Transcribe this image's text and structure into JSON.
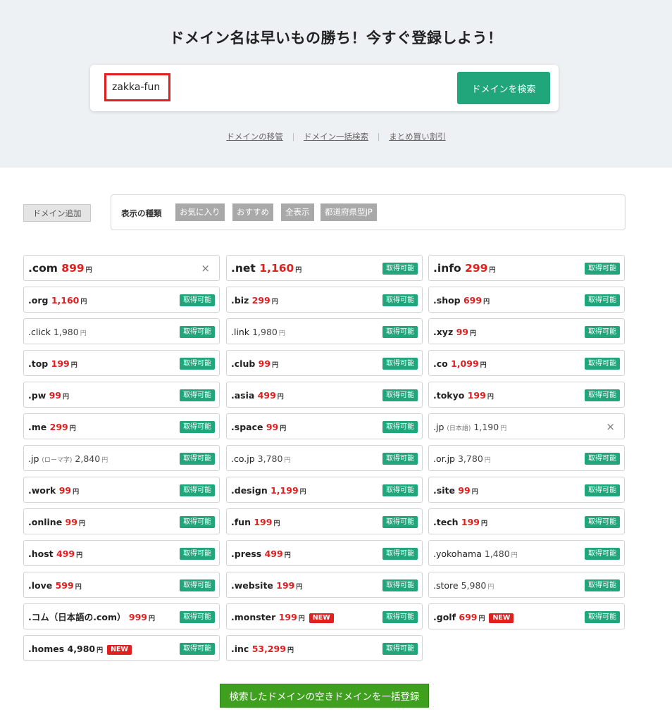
{
  "hero": {
    "title": "ドメイン名は早いもの勝ち！今すぐ登録しよう！",
    "search_value": "zakka-fun",
    "search_button": "ドメインを検索",
    "links": [
      "ドメインの移管",
      "ドメイン一括検索",
      "まとめ買い割引"
    ],
    "separator": "|"
  },
  "filters": {
    "add_button": "ドメイン追加",
    "label": "表示の種類",
    "chips": [
      "お気に入り",
      "おすすめ",
      "全表示",
      "都道府県型JP"
    ]
  },
  "yen": "円",
  "available_label": "取得可能",
  "new_label": "NEW",
  "close_symbol": "×",
  "domains": [
    {
      "tld": ".com",
      "price": "899",
      "status": "close",
      "large": true
    },
    {
      "tld": ".net",
      "price": "1,160",
      "status": "available",
      "large": true
    },
    {
      "tld": ".info",
      "price": "299",
      "status": "available",
      "large": true
    },
    {
      "tld": ".org",
      "price": "1,160",
      "status": "available"
    },
    {
      "tld": ".biz",
      "price": "299",
      "status": "available"
    },
    {
      "tld": ".shop",
      "price": "699",
      "status": "available"
    },
    {
      "tld": ".click",
      "price": "1,980",
      "status": "available",
      "plain": true
    },
    {
      "tld": ".link",
      "price": "1,980",
      "status": "available",
      "plain": true
    },
    {
      "tld": ".xyz",
      "price": "99",
      "status": "available"
    },
    {
      "tld": ".top",
      "price": "199",
      "status": "available"
    },
    {
      "tld": ".club",
      "price": "99",
      "status": "available"
    },
    {
      "tld": ".co",
      "price": "1,099",
      "status": "available"
    },
    {
      "tld": ".pw",
      "price": "99",
      "status": "available"
    },
    {
      "tld": ".asia",
      "price": "499",
      "status": "available"
    },
    {
      "tld": ".tokyo",
      "price": "199",
      "status": "available"
    },
    {
      "tld": ".me",
      "price": "299",
      "status": "available"
    },
    {
      "tld": ".space",
      "price": "99",
      "status": "available"
    },
    {
      "tld": ".jp",
      "note": "(日本語)",
      "price": "1,190",
      "status": "close",
      "plain": true,
      "unavailable": true
    },
    {
      "tld": ".jp",
      "note": "(ローマ字)",
      "price": "2,840",
      "status": "available",
      "plain": true
    },
    {
      "tld": ".co.jp",
      "price": "3,780",
      "status": "available",
      "plain": true
    },
    {
      "tld": ".or.jp",
      "price": "3,780",
      "status": "available",
      "plain": true
    },
    {
      "tld": ".work",
      "price": "99",
      "status": "available"
    },
    {
      "tld": ".design",
      "price": "1,199",
      "status": "available"
    },
    {
      "tld": ".site",
      "price": "99",
      "status": "available"
    },
    {
      "tld": ".online",
      "price": "99",
      "status": "available"
    },
    {
      "tld": ".fun",
      "price": "199",
      "status": "available"
    },
    {
      "tld": ".tech",
      "price": "199",
      "status": "available"
    },
    {
      "tld": ".host",
      "price": "499",
      "status": "available"
    },
    {
      "tld": ".press",
      "price": "499",
      "status": "available"
    },
    {
      "tld": ".yokohama",
      "price": "1,480",
      "status": "available",
      "plain": true
    },
    {
      "tld": ".love",
      "price": "599",
      "status": "available"
    },
    {
      "tld": ".website",
      "price": "199",
      "status": "available"
    },
    {
      "tld": ".store",
      "price": "5,980",
      "status": "available",
      "plain": true
    },
    {
      "tld": ".コム（日本語の.com）",
      "price": "999",
      "status": "available"
    },
    {
      "tld": ".monster",
      "price": "199",
      "status": "available",
      "is_new": true
    },
    {
      "tld": ".golf",
      "price": "699",
      "status": "available",
      "is_new": true
    },
    {
      "tld": ".homes",
      "price": "4,980",
      "status": "available",
      "is_new": true,
      "dark_price": true
    },
    {
      "tld": ".inc",
      "price": "53,299",
      "status": "available"
    }
  ],
  "bulk_button": "検索したドメインの空きドメインを一括登録"
}
